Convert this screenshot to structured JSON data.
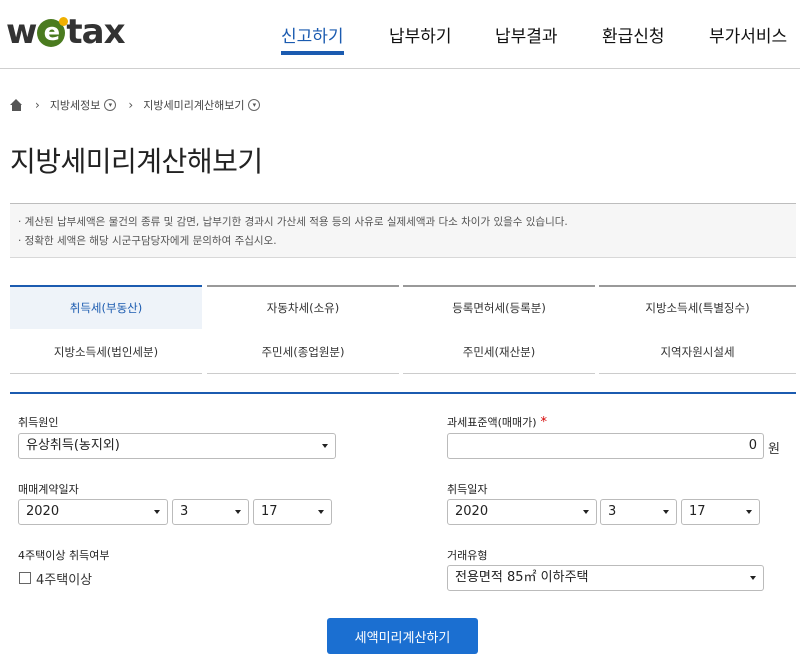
{
  "header": {
    "logo_pre": "w",
    "logo_e": "e",
    "logo_post": "tax",
    "nav": [
      "신고하기",
      "납부하기",
      "납부결과",
      "환급신청",
      "부가서비스"
    ]
  },
  "breadcrumb": {
    "items": [
      "지방세정보",
      "지방세미리계산해보기"
    ]
  },
  "page_title": "지방세미리계산해보기",
  "notice": [
    "· 계산된 납부세액은 물건의 종류 및 감면, 납부기한 경과시 가산세 적용 등의 사유로 실제세액과 다소 차이가 있을수 있습니다.",
    "· 정확한 세액은 해당 시군구담당자에게 문의하여 주십시오."
  ],
  "tabs": {
    "row1": [
      "취득세(부동산)",
      "자동차세(소유)",
      "등록면허세(등록분)",
      "지방소득세(특별징수)"
    ],
    "row2": [
      "지방소득세(법인세분)",
      "주민세(종업원분)",
      "주민세(재산분)",
      "지역자원시설세"
    ]
  },
  "form": {
    "acquisition_cause": {
      "label": "취득원인",
      "value": "유상취득(농지외)"
    },
    "tax_base": {
      "label": "과세표준액(매매가)",
      "required_mark": "*",
      "value": "0",
      "unit": "원"
    },
    "contract_date": {
      "label": "매매계약일자",
      "year": "2020",
      "month": "3",
      "day": "17"
    },
    "acquisition_date": {
      "label": "취득일자",
      "year": "2020",
      "month": "3",
      "day": "17"
    },
    "four_houses": {
      "label": "4주택이상 취득여부",
      "checkbox_label": "4주택이상"
    },
    "trade_type": {
      "label": "거래유형",
      "value": "전용면적 85㎡ 이하주택"
    }
  },
  "submit_label": "세액미리계산하기"
}
